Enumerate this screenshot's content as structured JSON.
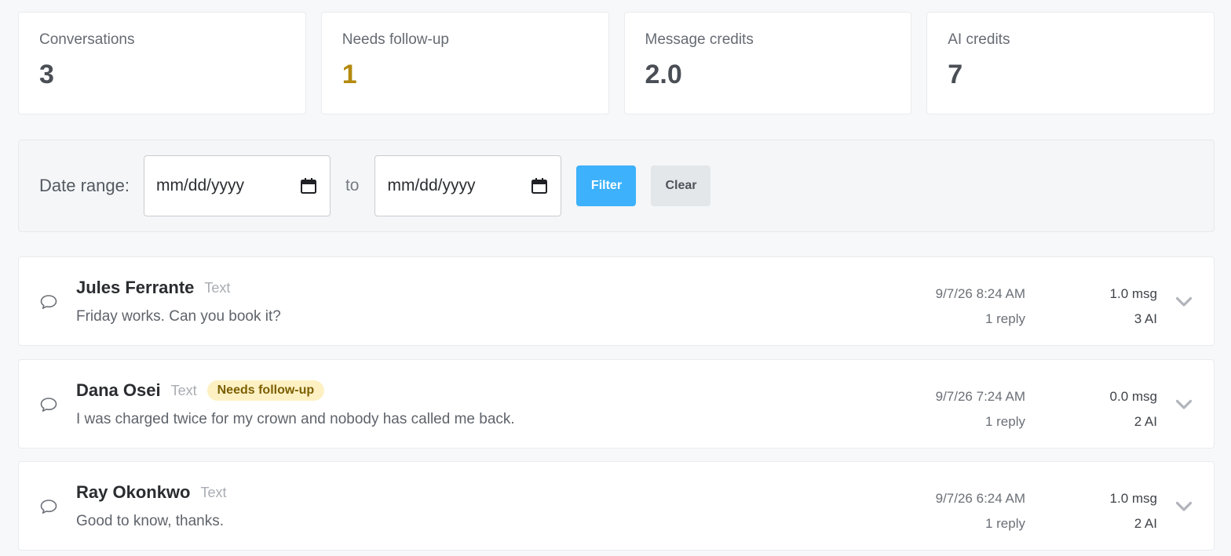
{
  "stats": [
    {
      "label": "Conversations",
      "value": "3"
    },
    {
      "label": "Needs follow-up",
      "value": "1"
    },
    {
      "label": "Message credits",
      "value": "2.0"
    },
    {
      "label": "AI credits",
      "value": "7"
    }
  ],
  "filter": {
    "label": "Date range:",
    "start_placeholder": "mm/dd/yyyy",
    "to_label": "to",
    "end_placeholder": "mm/dd/yyyy",
    "filter_button": "Filter",
    "clear_button": "Clear"
  },
  "conversations": [
    {
      "name": "Jules Ferrante",
      "channel": "Text",
      "badge": "",
      "preview": "Friday works. Can you book it?",
      "time": "9/7/26 8:24 AM",
      "replies": "1 reply",
      "msg_credits": "1.0 msg",
      "ai_credits": "3 AI"
    },
    {
      "name": "Dana Osei",
      "channel": "Text",
      "badge": "Needs follow-up",
      "preview": "I was charged twice for my crown and nobody has called me back.",
      "time": "9/7/26 7:24 AM",
      "replies": "1 reply",
      "msg_credits": "0.0 msg",
      "ai_credits": "2 AI"
    },
    {
      "name": "Ray Okonkwo",
      "channel": "Text",
      "badge": "",
      "preview": "Good to know, thanks.",
      "time": "9/7/26 6:24 AM",
      "replies": "1 reply",
      "msg_credits": "1.0 msg",
      "ai_credits": "2 AI"
    }
  ],
  "colors": {
    "accent": "#3db1fb",
    "warning_text": "#b48a0f",
    "badge_bg": "#fdf1c4"
  },
  "icons": {
    "date": "calendar-icon",
    "conversation": "chat-bubble-icon",
    "expand": "chevron-down-icon"
  }
}
